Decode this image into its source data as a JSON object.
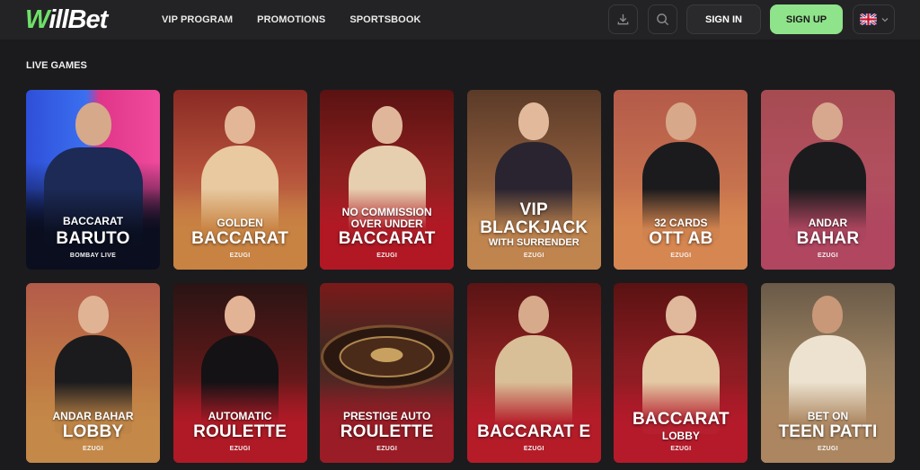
{
  "brand": {
    "logo_w": "W",
    "logo_rest": "illBet"
  },
  "nav": [
    "VIP PROGRAM",
    "PROMOTIONS",
    "SPORTSBOOK"
  ],
  "auth": {
    "sign_in": "SIGN IN",
    "sign_up": "SIGN UP"
  },
  "colors": {
    "accent": "#8fe38a",
    "background": "#1b1b1d",
    "header": "#232325"
  },
  "icons": {
    "download": "download-icon",
    "search": "search-icon",
    "language": "uk-flag-icon"
  },
  "section": {
    "title": "LIVE GAMES"
  },
  "games": [
    {
      "line1": "BACCARAT",
      "line2": "BARUTO",
      "line3": "",
      "provider": "BOMBAY LIVE"
    },
    {
      "line1": "GOLDEN",
      "line2": "BACCARAT",
      "line3": "",
      "provider": "EZUGI"
    },
    {
      "line1": "NO COMMISSION\nOVER UNDER",
      "line2": "BACCARAT",
      "line3": "",
      "provider": "EZUGI"
    },
    {
      "line1": "VIP\nBLACKJACK",
      "line2": "",
      "line3": "WITH SURRENDER",
      "provider": "EZUGI"
    },
    {
      "line1": "32 CARDS",
      "line2": "OTT AB",
      "line3": "",
      "provider": "EZUGI"
    },
    {
      "line1": "ANDAR",
      "line2": "BAHAR",
      "line3": "",
      "provider": "EZUGI"
    },
    {
      "line1": "ANDAR BAHAR",
      "line2": "LOBBY",
      "line3": "",
      "provider": "EZUGI"
    },
    {
      "line1": "AUTOMATIC",
      "line2": "ROULETTE",
      "line3": "",
      "provider": "EZUGI"
    },
    {
      "line1": "PRESTIGE AUTO",
      "line2": "ROULETTE",
      "line3": "",
      "provider": "EZUGI"
    },
    {
      "line1": "",
      "line2": "BACCARAT E",
      "line3": "",
      "provider": "EZUGI"
    },
    {
      "line1": "",
      "line2": "BACCARAT",
      "line3": "LOBBY",
      "provider": "EZUGI"
    },
    {
      "line1": "BET ON",
      "line2": "TEEN PATTI",
      "line3": "",
      "provider": "EZUGI"
    }
  ]
}
